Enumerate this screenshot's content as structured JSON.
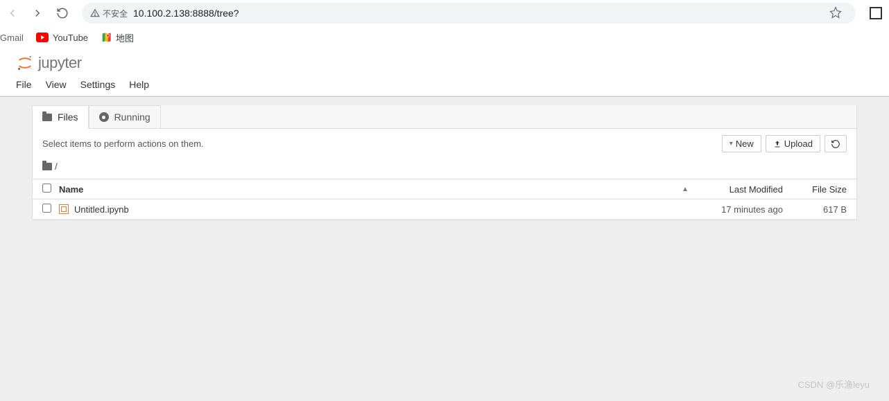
{
  "browser": {
    "security_label": "不安全",
    "url": "10.100.2.138:8888/tree?"
  },
  "bookmarks": {
    "gmail": "Gmail",
    "youtube": "YouTube",
    "map": "地图"
  },
  "logo_text": "jupyter",
  "menubar": {
    "file": "File",
    "view": "View",
    "settings": "Settings",
    "help": "Help"
  },
  "tabs": {
    "files": "Files",
    "running": "Running"
  },
  "toolbar": {
    "hint": "Select items to perform actions on them.",
    "new": "New",
    "upload": "Upload"
  },
  "breadcrumb": "/",
  "columns": {
    "name": "Name",
    "modified": "Last Modified",
    "size": "File Size"
  },
  "files": [
    {
      "name": "Untitled.ipynb",
      "modified": "17 minutes ago",
      "size": "617 B"
    }
  ],
  "watermark": "CSDN @乐渔leyu"
}
